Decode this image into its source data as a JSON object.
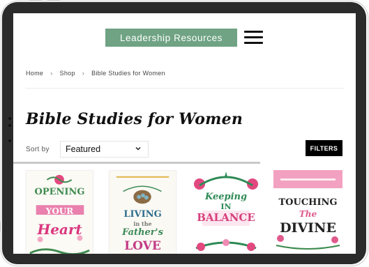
{
  "header": {
    "brand_label": "Leadership Resources",
    "menu_icon": "hamburger-menu-icon"
  },
  "breadcrumb": {
    "items": [
      "Home",
      "Shop",
      "Bible Studies for Women"
    ],
    "separator": "›"
  },
  "page": {
    "title": "Bible Studies for Women"
  },
  "toolbar": {
    "sort_label": "Sort by",
    "sort_value": "Featured",
    "filters_label": "FILTERS"
  },
  "products": [
    {
      "cover_lines": [
        "OPENING",
        "YOUR",
        "Heart"
      ],
      "accent": "#d9377e",
      "secondary": "#3f8a4f"
    },
    {
      "cover_lines": [
        "LIVING",
        "in the",
        "Father's",
        "LOVE"
      ],
      "accent": "#c23b86",
      "secondary": "#2f6f8f"
    },
    {
      "cover_lines": [
        "Keeping",
        "IN",
        "BALANCE"
      ],
      "accent": "#2e8a55",
      "secondary": "#d63f7a"
    },
    {
      "cover_lines": [
        "TOUCHING",
        "The",
        "DIVINE"
      ],
      "accent": "#222222",
      "secondary": "#e05a8c"
    }
  ],
  "colors": {
    "brand": "#6fa383",
    "frame": "#2b2b2b",
    "filters_bg": "#000000"
  }
}
